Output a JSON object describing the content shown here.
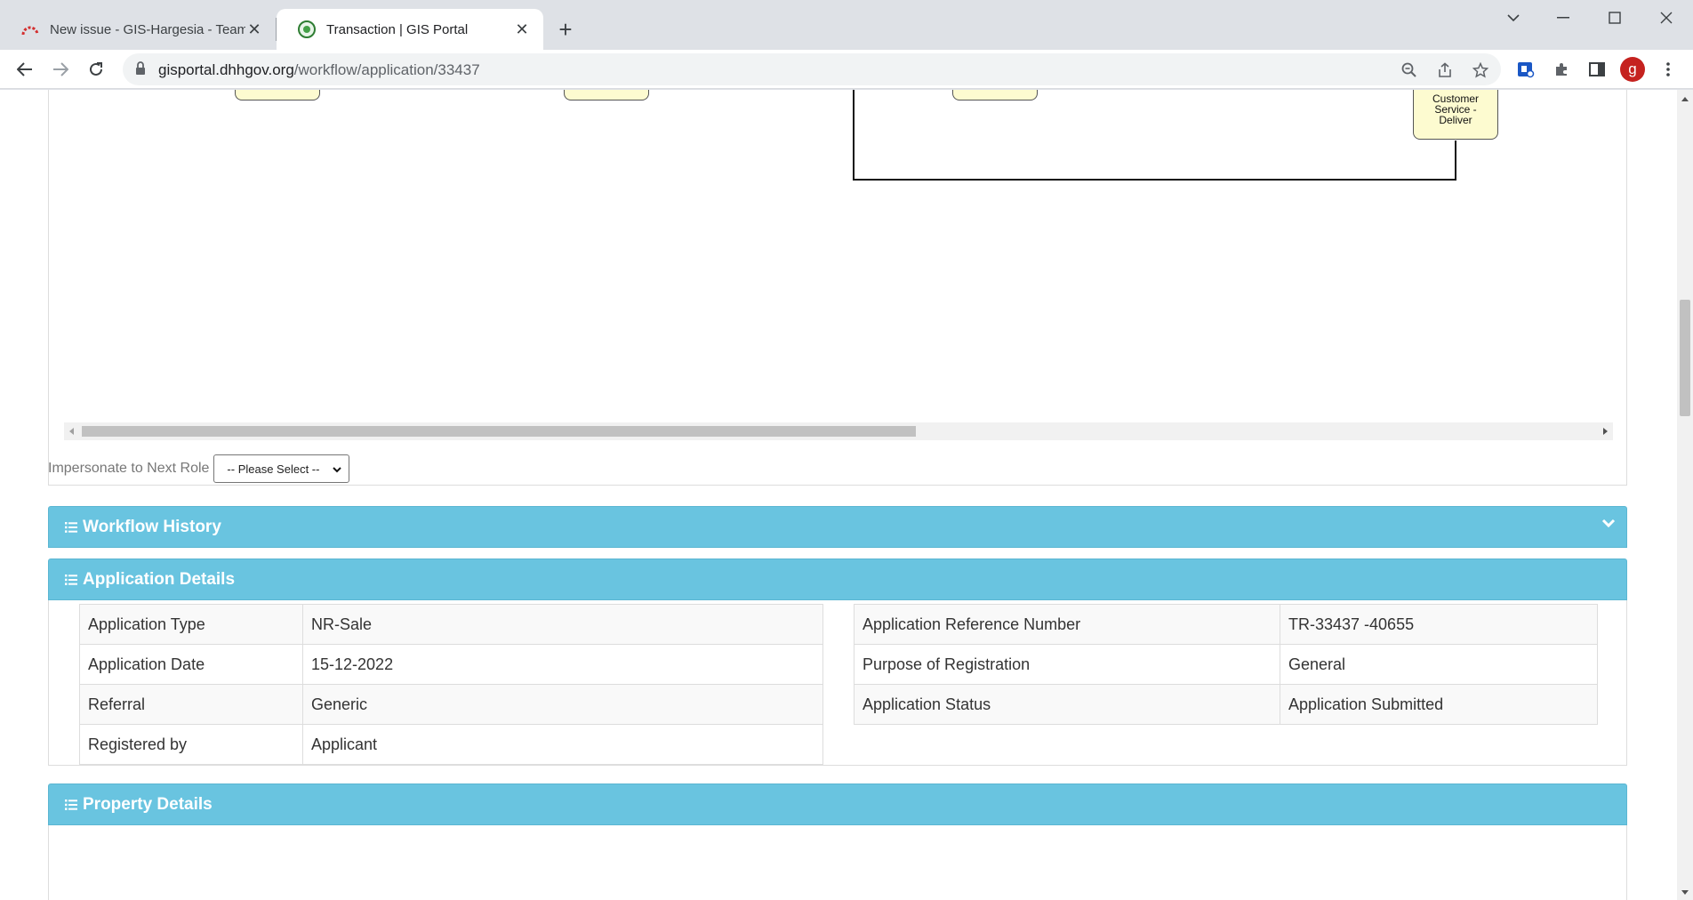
{
  "browser": {
    "tabs": [
      {
        "title": "New issue - GIS-Hargesia - Team",
        "active": false
      },
      {
        "title": "Transaction | GIS Portal",
        "active": true
      }
    ],
    "url_host": "gisportal.dhhgov.org",
    "url_path": "/workflow/application/33437",
    "profile_initial": "g"
  },
  "diagram": {
    "node_label": "Customer Service - Deliver"
  },
  "impersonate": {
    "label": "Impersonate to Next Role",
    "select_value": "-- Please Select --"
  },
  "workflow_history": {
    "title": "Workflow History"
  },
  "application_details": {
    "title": "Application Details",
    "left_rows": [
      {
        "label": "Application Type",
        "value": "NR-Sale"
      },
      {
        "label": "Application Date",
        "value": "15-12-2022"
      },
      {
        "label": "Referral",
        "value": "Generic"
      },
      {
        "label": "Registered by",
        "value": "Applicant"
      }
    ],
    "right_rows": [
      {
        "label": "Application Reference Number",
        "value": "TR-33437 -40655"
      },
      {
        "label": "Purpose of Registration",
        "value": "General"
      },
      {
        "label": "Application Status",
        "value": "Application Submitted"
      }
    ]
  },
  "property_details": {
    "title": "Property Details"
  },
  "colors": {
    "panel_header": "#69c4e0",
    "node_fill": "#fdfbd0"
  }
}
